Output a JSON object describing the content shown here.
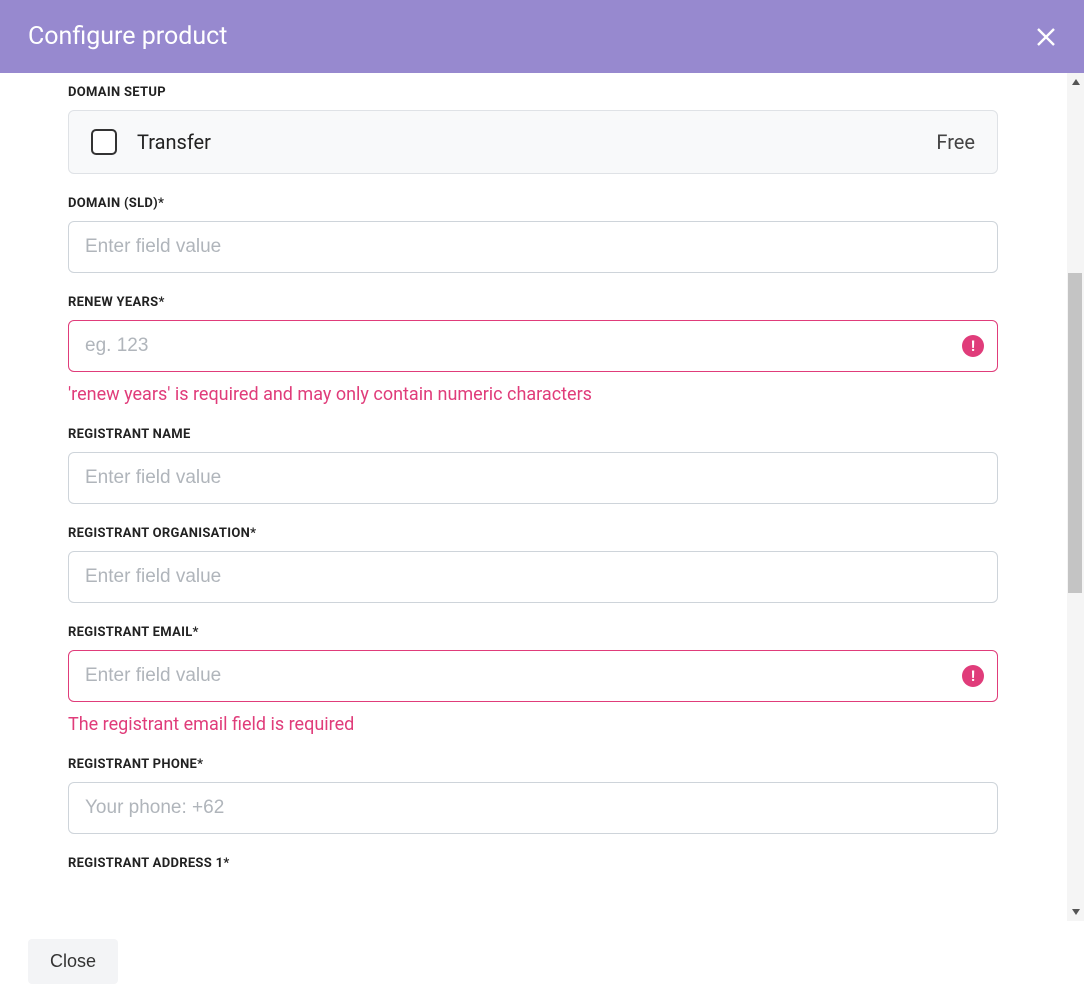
{
  "header": {
    "title": "Configure product"
  },
  "domain_setup": {
    "label": "DOMAIN SETUP",
    "option_label": "Transfer",
    "option_price": "Free"
  },
  "fields": {
    "sld": {
      "label": "DOMAIN (SLD)*",
      "placeholder": "Enter field value"
    },
    "renew_years": {
      "label": "RENEW YEARS*",
      "placeholder": "eg. 123",
      "error": "'renew years' is required and may only contain numeric characters"
    },
    "registrant_name": {
      "label": "REGISTRANT NAME",
      "placeholder": "Enter field value"
    },
    "registrant_org": {
      "label": "REGISTRANT ORGANISATION*",
      "placeholder": "Enter field value"
    },
    "registrant_email": {
      "label": "REGISTRANT EMAIL*",
      "placeholder": "Enter field value",
      "error": "The registrant email field is required"
    },
    "registrant_phone": {
      "label": "REGISTRANT PHONE*",
      "placeholder": "Your phone: +62"
    },
    "registrant_address1": {
      "label": "REGISTRANT ADDRESS 1*"
    }
  },
  "footer": {
    "close_label": "Close"
  }
}
